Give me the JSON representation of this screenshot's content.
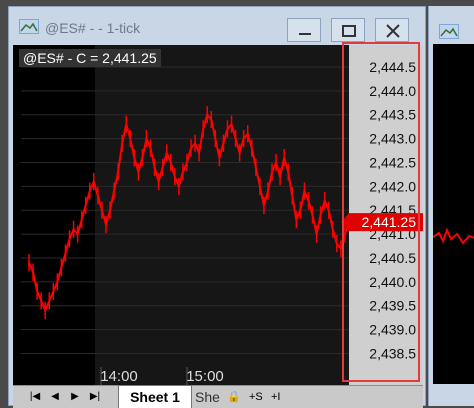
{
  "window": {
    "title": "@ES# -  - 1-tick",
    "minimize_label": "minimize",
    "maximize_label": "maximize",
    "close_label": "close"
  },
  "chart_data": {
    "type": "line",
    "title": "@ES# - C = 2,441.25",
    "last_price_label": "2,441.25",
    "last_price": 2441.25,
    "price_axis_ticks": [
      "2,444.5",
      "2,444.0",
      "2,443.5",
      "2,443.0",
      "2,442.5",
      "2,442.0",
      "2,441.5",
      "2,441.0",
      "2,440.5",
      "2,440.0",
      "2,439.5",
      "2,439.0",
      "2,438.5"
    ],
    "ylim": [
      2438.3,
      2444.75
    ],
    "time_axis_ticks": [
      "14:00",
      "15:00"
    ],
    "series": [
      {
        "color": "#ff0000",
        "values": [
          2440.4,
          2440.2,
          2439.8,
          2439.6,
          2439.4,
          2439.6,
          2439.8,
          2440.0,
          2440.3,
          2440.6,
          2440.9,
          2441.1,
          2441.0,
          2441.3,
          2441.6,
          2441.9,
          2442.1,
          2441.8,
          2441.5,
          2441.2,
          2441.5,
          2441.9,
          2442.3,
          2442.9,
          2443.3,
          2443.0,
          2442.6,
          2442.3,
          2442.6,
          2443.0,
          2442.8,
          2442.4,
          2442.1,
          2442.4,
          2442.7,
          2442.5,
          2442.2,
          2442.0,
          2442.3,
          2442.5,
          2442.8,
          2442.9,
          2442.7,
          2443.2,
          2443.5,
          2443.4,
          2443.0,
          2442.6,
          2442.9,
          2443.2,
          2443.3,
          2443.0,
          2442.7,
          2443.0,
          2443.1,
          2442.8,
          2442.4,
          2442.0,
          2441.6,
          2441.9,
          2442.3,
          2442.5,
          2442.2,
          2442.6,
          2442.3,
          2441.8,
          2441.3,
          2441.5,
          2441.9,
          2441.7,
          2441.4,
          2441.0,
          2441.4,
          2441.7,
          2441.5,
          2441.1,
          2440.8,
          2440.7,
          2441.0,
          2441.25
        ]
      }
    ]
  },
  "tabs": {
    "first_label": "|◀",
    "prev_label": "◀",
    "next_label": "▶",
    "last_label": "▶|",
    "sheet1": "Sheet 1",
    "sheet2": "She",
    "lock": "🔒",
    "add_sheet": "+S",
    "insert": "+I"
  },
  "colors": {
    "series": "#ff0000",
    "background": "#000000",
    "highlight": "#e23b3b"
  }
}
